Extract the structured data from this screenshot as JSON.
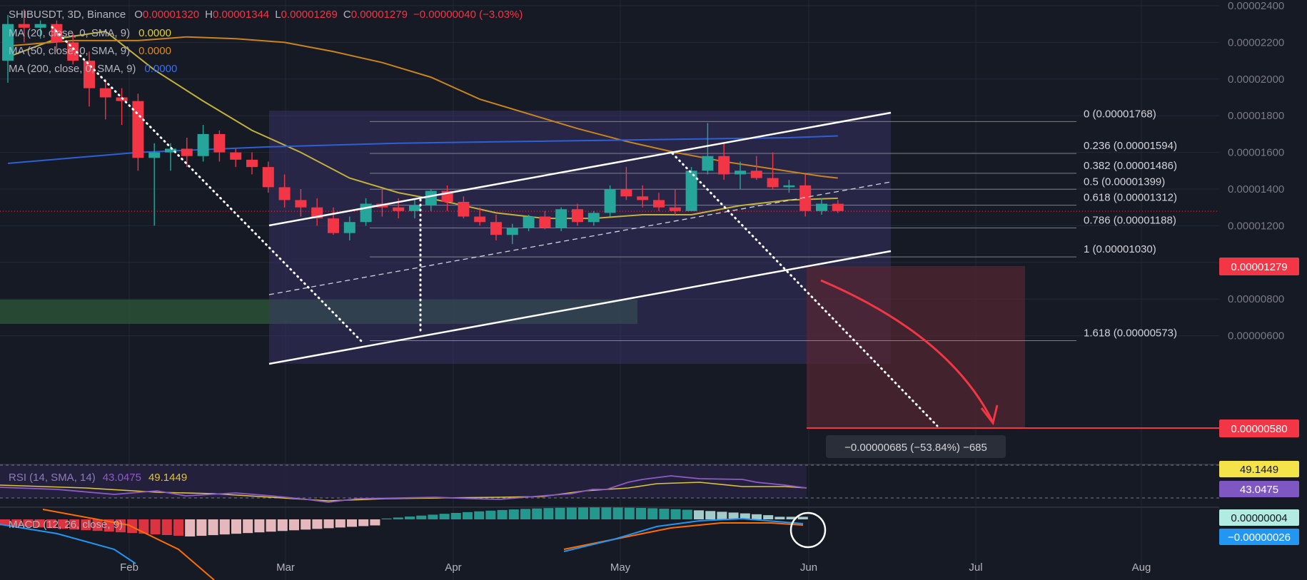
{
  "header": {
    "symbol": "SHIBUSDT, 3D, Binance",
    "o_label": "O",
    "o_value": "0.00001320",
    "h_label": "H",
    "h_value": "0.00001344",
    "l_label": "L",
    "l_value": "0.00001269",
    "c_label": "C",
    "c_value": "0.00001279",
    "change": "−0.00000040 (−3.03%)"
  },
  "ma_legend": [
    {
      "label": "MA (20, close, 0, SMA, 9)",
      "value": "0.0000",
      "color": "#d4c43a"
    },
    {
      "label": "MA (50, close, 0, SMA, 9)",
      "value": "0.0000",
      "color": "#d68a1f"
    },
    {
      "label": "MA (200, close, 0, SMA, 9)",
      "value": "0.0000",
      "color": "#2f5fd6"
    }
  ],
  "colors": {
    "background": "#161a25",
    "grid": "#232836",
    "up": "#26a69a",
    "down": "#f23645",
    "ma20": "#c2b13b",
    "ma50": "#c9841e",
    "ma200": "#2f5fd6",
    "channel_fill": "#3b3570",
    "rsi": "#8e5ac8",
    "rsi_ma": "#e0c33a",
    "macd": "#2196f3",
    "signal": "#ff6d00",
    "target": "#f23645"
  },
  "chart_data": {
    "type": "candlestick",
    "symbol": "SHIBUSDT",
    "timeframe": "3D",
    "exchange": "Binance",
    "x_ticks": [
      "Feb",
      "Mar",
      "Apr",
      "May",
      "Jun",
      "Jul",
      "Aug"
    ],
    "y_ticks": [
      "0.00002400",
      "0.00002200",
      "0.00002000",
      "0.00001800",
      "0.00001600",
      "0.00001400",
      "0.00001200",
      "0.00001000",
      "0.00000800",
      "0.00000600"
    ],
    "ylim": [
      5.1e-06,
      2.42e-05
    ],
    "candles": [
      [
        2.1e-05,
        2.35e-05,
        1.98e-05,
        2.3e-05
      ],
      [
        2.3e-05,
        2.38e-05,
        2.2e-05,
        2.28e-05
      ],
      [
        2.28e-05,
        2.32e-05,
        2.22e-05,
        2.3e-05
      ],
      [
        2.3e-05,
        2.32e-05,
        2.15e-05,
        2.2e-05
      ],
      [
        2.2e-05,
        2.25e-05,
        2.08e-05,
        2.1e-05
      ],
      [
        2.1e-05,
        2.15e-05,
        1.85e-05,
        1.95e-05
      ],
      [
        1.95e-05,
        2e-05,
        1.78e-05,
        1.9e-05
      ],
      [
        1.9e-05,
        1.95e-05,
        1.75e-05,
        1.88e-05
      ],
      [
        1.88e-05,
        1.92e-05,
        1.5e-05,
        1.57e-05
      ],
      [
        1.57e-05,
        1.65e-05,
        1.2e-05,
        1.6e-05
      ],
      [
        1.6e-05,
        1.65e-05,
        1.5e-05,
        1.62e-05
      ],
      [
        1.62e-05,
        1.68e-05,
        1.52e-05,
        1.58e-05
      ],
      [
        1.58e-05,
        1.75e-05,
        1.55e-05,
        1.7e-05
      ],
      [
        1.7e-05,
        1.72e-05,
        1.55e-05,
        1.6e-05
      ],
      [
        1.6e-05,
        1.62e-05,
        1.52e-05,
        1.56e-05
      ],
      [
        1.56e-05,
        1.6e-05,
        1.48e-05,
        1.52e-05
      ],
      [
        1.52e-05,
        1.55e-05,
        1.38e-05,
        1.41e-05
      ],
      [
        1.41e-05,
        1.48e-05,
        1.3e-05,
        1.34e-05
      ],
      [
        1.34e-05,
        1.4e-05,
        1.25e-05,
        1.3e-05
      ],
      [
        1.3e-05,
        1.35e-05,
        1.2e-05,
        1.24e-05
      ],
      [
        1.24e-05,
        1.3e-05,
        1.15e-05,
        1.16e-05
      ],
      [
        1.16e-05,
        1.25e-05,
        1.12e-05,
        1.22e-05
      ],
      [
        1.22e-05,
        1.35e-05,
        1.2e-05,
        1.32e-05
      ],
      [
        1.32e-05,
        1.4e-05,
        1.25e-05,
        1.3e-05
      ],
      [
        1.3e-05,
        1.35e-05,
        1.24e-05,
        1.28e-05
      ],
      [
        1.28e-05,
        1.35e-05,
        1.24e-05,
        1.31e-05
      ],
      [
        1.31e-05,
        1.4e-05,
        1.28e-05,
        1.39e-05
      ],
      [
        1.39e-05,
        1.42e-05,
        1.28e-05,
        1.33e-05
      ],
      [
        1.33e-05,
        1.36e-05,
        1.24e-05,
        1.25e-05
      ],
      [
        1.25e-05,
        1.3e-05,
        1.2e-05,
        1.22e-05
      ],
      [
        1.22e-05,
        1.26e-05,
        1.12e-05,
        1.15e-05
      ],
      [
        1.15e-05,
        1.21e-05,
        1.1e-05,
        1.19e-05
      ],
      [
        1.19e-05,
        1.26e-05,
        1.17e-05,
        1.25e-05
      ],
      [
        1.25e-05,
        1.28e-05,
        1.18e-05,
        1.19e-05
      ],
      [
        1.19e-05,
        1.3e-05,
        1.17e-05,
        1.29e-05
      ],
      [
        1.29e-05,
        1.32e-05,
        1.2e-05,
        1.22e-05
      ],
      [
        1.22e-05,
        1.28e-05,
        1.2e-05,
        1.27e-05
      ],
      [
        1.27e-05,
        1.42e-05,
        1.25e-05,
        1.4e-05
      ],
      [
        1.4e-05,
        1.52e-05,
        1.34e-05,
        1.36e-05
      ],
      [
        1.36e-05,
        1.42e-05,
        1.3e-05,
        1.34e-05
      ],
      [
        1.34e-05,
        1.38e-05,
        1.28e-05,
        1.3e-05
      ],
      [
        1.3e-05,
        1.4e-05,
        1.26e-05,
        1.28e-05
      ],
      [
        1.28e-05,
        1.52e-05,
        1.28e-05,
        1.5e-05
      ],
      [
        1.5e-05,
        1.76e-05,
        1.48e-05,
        1.58e-05
      ],
      [
        1.58e-05,
        1.65e-05,
        1.45e-05,
        1.48e-05
      ],
      [
        1.48e-05,
        1.55e-05,
        1.4e-05,
        1.5e-05
      ],
      [
        1.5e-05,
        1.58e-05,
        1.45e-05,
        1.46e-05
      ],
      [
        1.46e-05,
        1.6e-05,
        1.4e-05,
        1.41e-05
      ],
      [
        1.41e-05,
        1.45e-05,
        1.38e-05,
        1.42e-05
      ],
      [
        1.42e-05,
        1.48e-05,
        1.25e-05,
        1.28e-05
      ],
      [
        1.28e-05,
        1.35e-05,
        1.26e-05,
        1.32e-05
      ],
      [
        1.32e-05,
        1.34e-05,
        1.27e-05,
        1.28e-05
      ]
    ],
    "current_price": "0.00001279",
    "target_price": "0.00000580",
    "measure_label": "−0.00000685 (−53.84%) −685",
    "fib_levels": [
      {
        "ratio": 0,
        "price": 1.768e-05,
        "label": "0 (0.00001768)"
      },
      {
        "ratio": 0.236,
        "price": 1.594e-05,
        "label": "0.236 (0.00001594)"
      },
      {
        "ratio": 0.382,
        "price": 1.486e-05,
        "label": "0.382 (0.00001486)"
      },
      {
        "ratio": 0.5,
        "price": 1.399e-05,
        "label": "0.5 (0.00001399)"
      },
      {
        "ratio": 0.618,
        "price": 1.312e-05,
        "label": "0.618 (0.00001312)"
      },
      {
        "ratio": 0.786,
        "price": 1.188e-05,
        "label": "0.786 (0.00001188)"
      },
      {
        "ratio": 1,
        "price": 1.03e-05,
        "label": "1 (0.00001030)"
      },
      {
        "ratio": 1.618,
        "price": 5.73e-06,
        "label": "1.618 (0.00000573)"
      }
    ],
    "rsi": {
      "label": "RSI (14, SMA, 14)",
      "value": "43.0475",
      "ma_value": "49.1449"
    },
    "macd": {
      "label": "MACD (12, 26, close, 9)",
      "hist_value": "0.00000004",
      "macd_value": "−0.00000026"
    }
  }
}
